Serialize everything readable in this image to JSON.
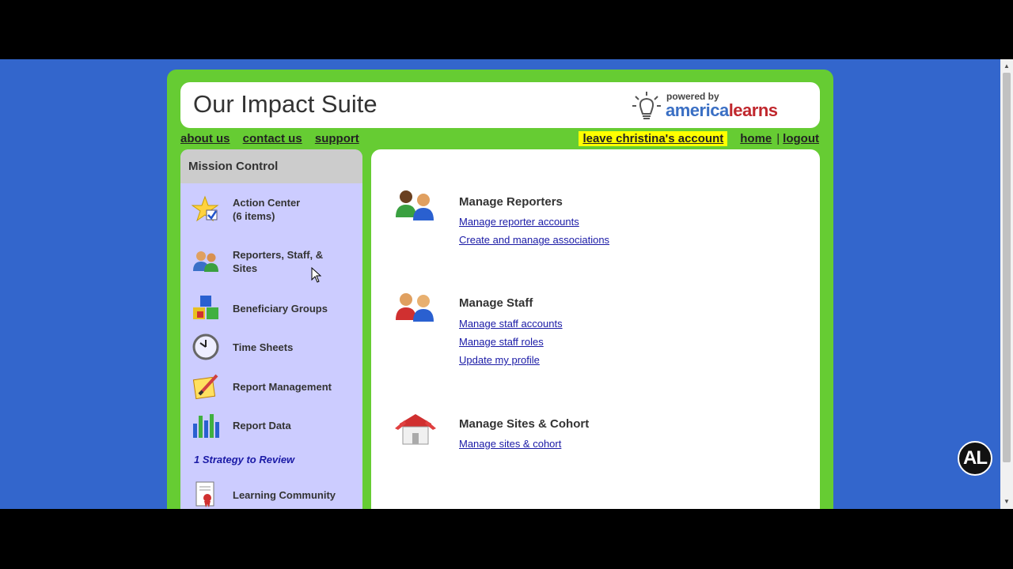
{
  "header": {
    "title": "Our Impact Suite",
    "logo_powered": "powered by",
    "logo_brand_part1": "america",
    "logo_brand_part2": "learns"
  },
  "nav": {
    "left": [
      "about us",
      "contact us",
      "support"
    ],
    "leave_account": "leave christina's account",
    "home": "home",
    "separator": "|",
    "logout": "logout"
  },
  "sidebar": {
    "heading": "Mission Control",
    "items": [
      {
        "label": "Action Center",
        "sub": "(6 items)",
        "icon": "star-check-icon"
      },
      {
        "label": "Reporters, Staff, &",
        "sub": "Sites",
        "icon": "people-icon"
      },
      {
        "label": "Beneficiary Groups",
        "sub": "",
        "icon": "blocks-icon"
      },
      {
        "label": "Time Sheets",
        "sub": "",
        "icon": "clock-icon"
      },
      {
        "label": "Report Management",
        "sub": "",
        "icon": "pencil-notepad-icon"
      },
      {
        "label": "Report Data",
        "sub": "",
        "icon": "bar-chart-icon"
      },
      {
        "label": "Learning Community",
        "sub": "",
        "icon": "certificate-icon"
      }
    ],
    "strategy_link": "1 Strategy to Review"
  },
  "main": {
    "sections": [
      {
        "title": "Manage Reporters",
        "icon": "reporters-icon",
        "links": [
          "Manage reporter accounts",
          "Create and manage associations"
        ]
      },
      {
        "title": "Manage Staff",
        "icon": "staff-icon",
        "links": [
          "Manage staff accounts",
          "Manage staff roles",
          "Update my profile"
        ]
      },
      {
        "title": "Manage Sites & Cohort",
        "icon": "house-icon",
        "links": [
          "Manage sites & cohort"
        ]
      }
    ]
  },
  "badge": "AL",
  "colors": {
    "background": "#3366cc",
    "frame": "#66cc33",
    "sidebar": "#ccccff",
    "highlight": "#ffff00",
    "link": "#1a1aa6"
  }
}
